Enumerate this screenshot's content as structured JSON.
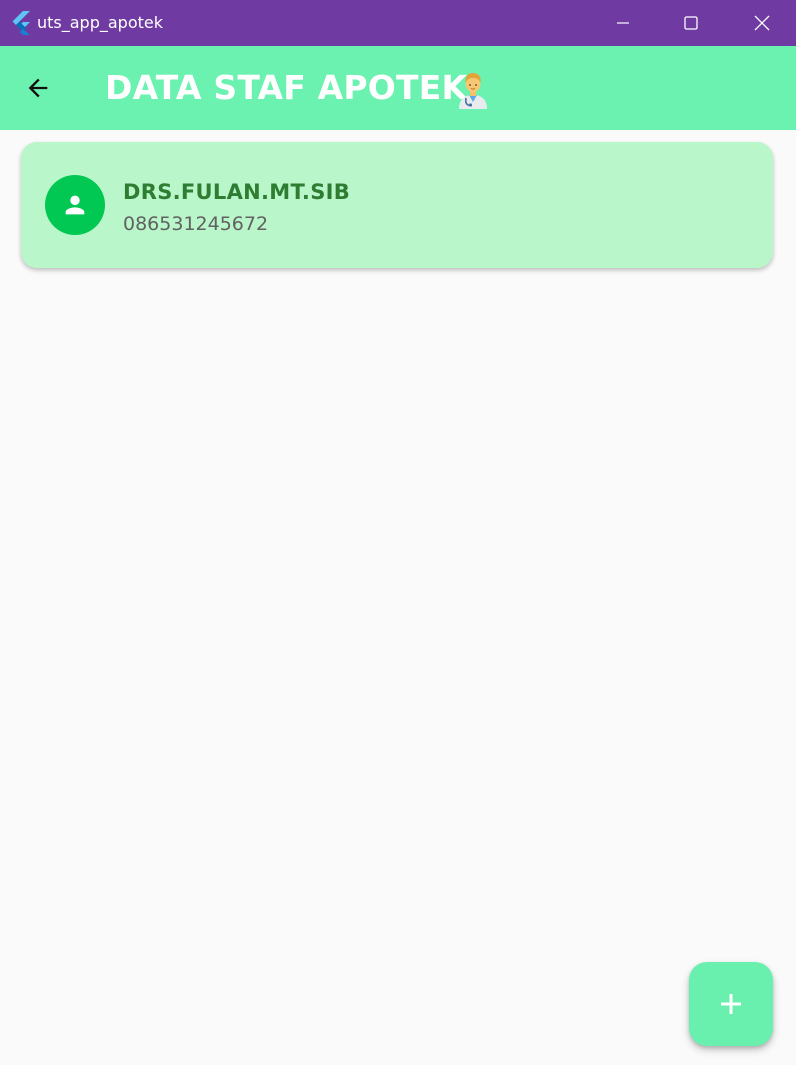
{
  "window": {
    "title": "uts_app_apotek",
    "icon": "flutter-logo-icon"
  },
  "appbar": {
    "title": "DATA STAF APOTEK",
    "back_icon": "arrow-left-icon",
    "title_icon": "health-worker-emoji-icon",
    "background": "#6bf2b0"
  },
  "staff": [
    {
      "name": "DRS.FULAN.MT.SIB",
      "phone": "086531245672",
      "avatar_icon": "person-icon"
    }
  ],
  "fab": {
    "icon": "plus-icon",
    "color": "#69f0ae"
  },
  "colors": {
    "titlebar": "#6f3ba3",
    "card": "#b9f6ca",
    "avatar": "#00c853",
    "name": "#2e7d32"
  }
}
